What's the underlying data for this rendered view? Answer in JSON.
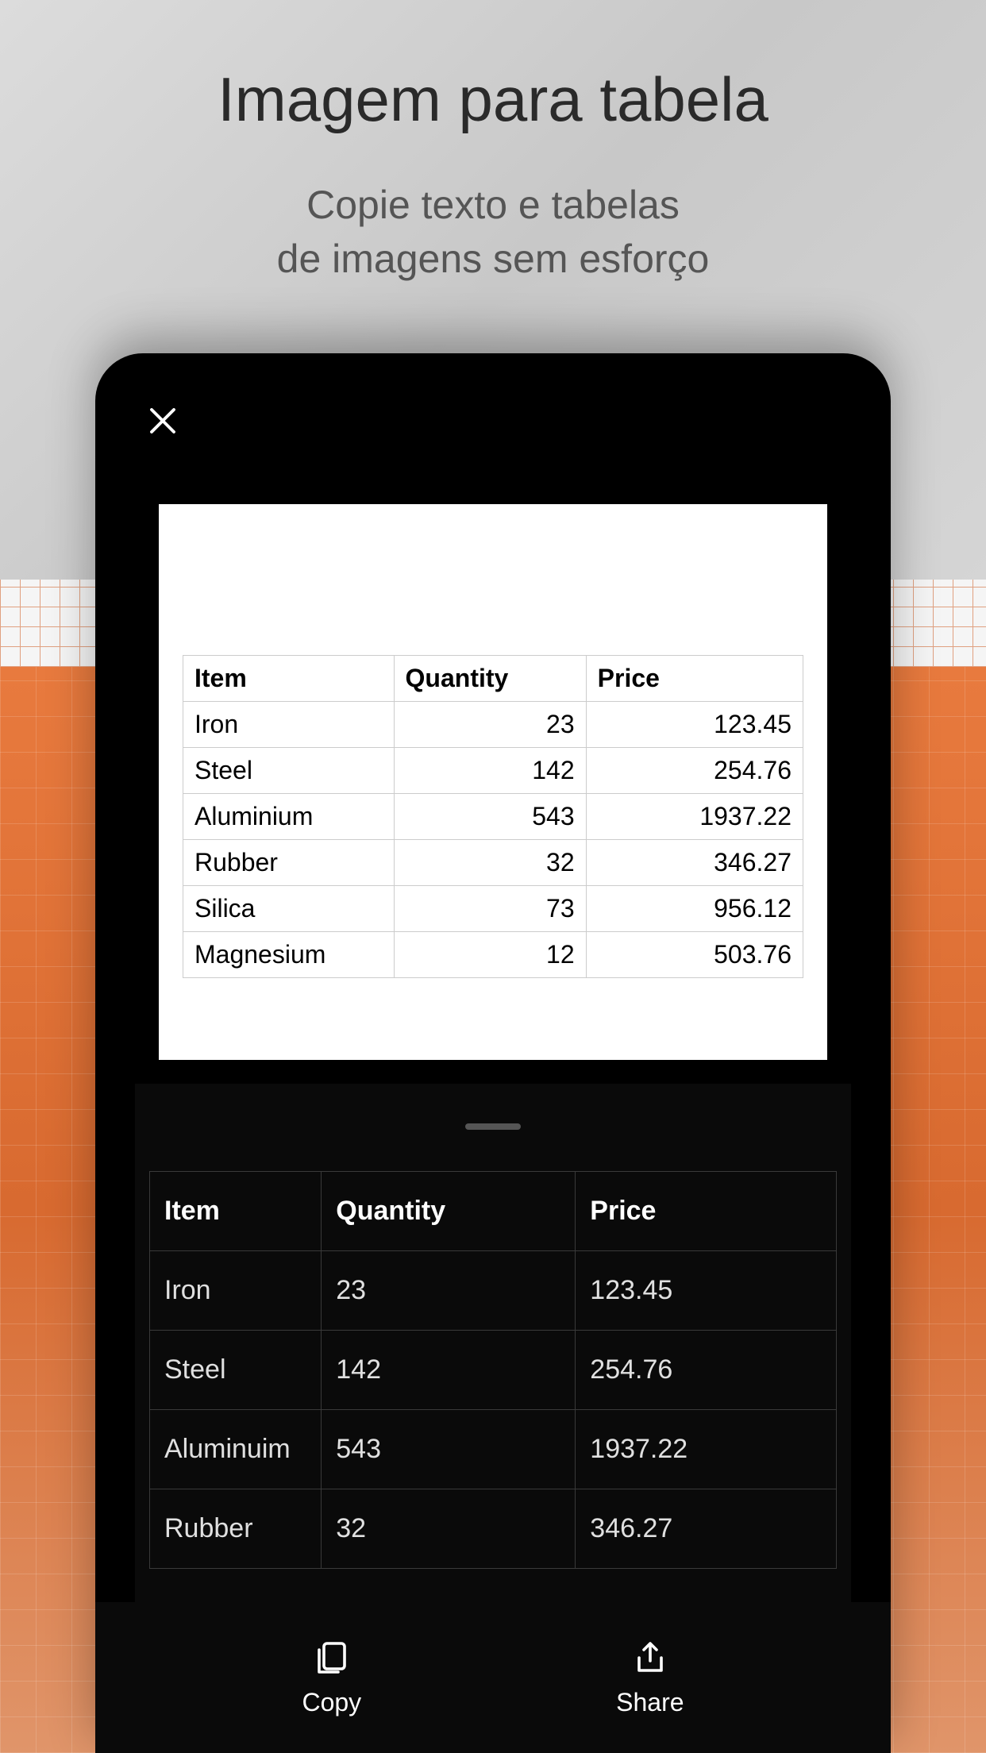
{
  "hero": {
    "title": "Imagem para tabela",
    "subtitle_line1": "Copie texto e tabelas",
    "subtitle_line2": "de imagens sem esforço"
  },
  "scanned_table": {
    "headers": [
      "Item",
      "Quantity",
      "Price"
    ],
    "rows": [
      {
        "item": "Iron",
        "quantity": "23",
        "price": "123.45"
      },
      {
        "item": "Steel",
        "quantity": "142",
        "price": "254.76"
      },
      {
        "item": "Aluminium",
        "quantity": "543",
        "price": "1937.22"
      },
      {
        "item": "Rubber",
        "quantity": "32",
        "price": "346.27"
      },
      {
        "item": "Silica",
        "quantity": "73",
        "price": "956.12"
      },
      {
        "item": "Magnesium",
        "quantity": "12",
        "price": "503.76"
      }
    ]
  },
  "result_table": {
    "headers": [
      "Item",
      "Quantity",
      "Price"
    ],
    "rows": [
      {
        "item": "Iron",
        "quantity": "23",
        "price": "123.45"
      },
      {
        "item": "Steel",
        "quantity": "142",
        "price": "254.76"
      },
      {
        "item": "Aluminuim",
        "quantity": "543",
        "price": "1937.22"
      },
      {
        "item": "Rubber",
        "quantity": "32",
        "price": "346.27"
      }
    ]
  },
  "actions": {
    "copy_label": "Copy",
    "share_label": "Share"
  }
}
